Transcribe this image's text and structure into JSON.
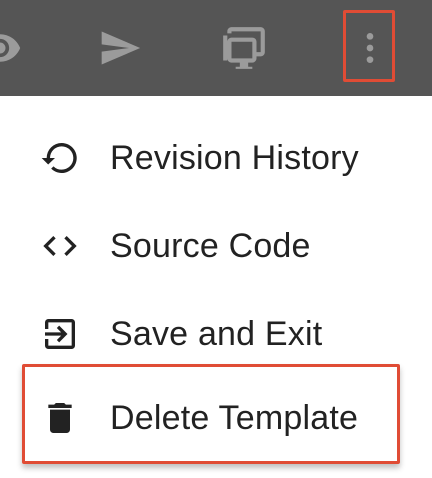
{
  "toolbar": {
    "icons": [
      "eye-icon",
      "send-icon",
      "monitor-icon",
      "more-vert-icon"
    ]
  },
  "menu": {
    "items": [
      {
        "label": "Revision History",
        "icon": "history-icon"
      },
      {
        "label": "Source Code",
        "icon": "code-icon"
      },
      {
        "label": "Save and Exit",
        "icon": "exit-icon"
      },
      {
        "label": "Delete Template",
        "icon": "trash-icon"
      }
    ]
  },
  "colors": {
    "toolbar_bg": "#555555",
    "icon_gray": "#9b9b9b",
    "highlight": "#e04c35",
    "text": "#222222"
  }
}
